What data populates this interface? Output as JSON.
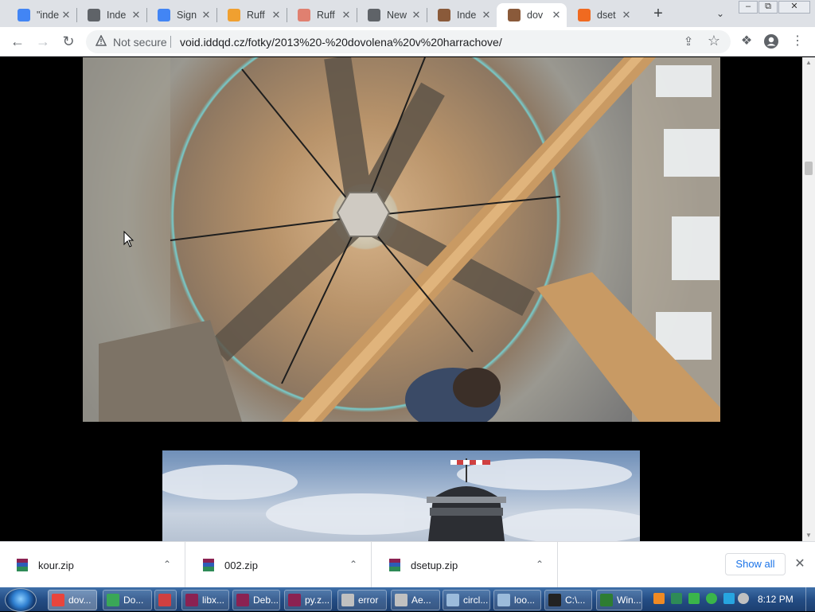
{
  "browser": {
    "tabs": [
      {
        "title": "\"inde",
        "favicon": "google-icon",
        "color": "#4285f4",
        "active": false
      },
      {
        "title": "Inde",
        "favicon": "globe-icon",
        "color": "#5f6368",
        "active": false
      },
      {
        "title": "Sign",
        "favicon": "google-icon",
        "color": "#4285f4",
        "active": false
      },
      {
        "title": "Ruff",
        "favicon": "ruffle-icon",
        "color": "#f0a030",
        "active": false
      },
      {
        "title": "Ruff",
        "favicon": "ruffle-icon",
        "color": "#e08070",
        "active": false
      },
      {
        "title": "New",
        "favicon": "chrome-icon",
        "color": "#5f6368",
        "active": false
      },
      {
        "title": "Inde",
        "favicon": "face-icon",
        "color": "#8a5a3a",
        "active": false
      },
      {
        "title": "dov",
        "favicon": "face-icon",
        "color": "#8a5a3a",
        "active": true
      },
      {
        "title": "dset",
        "favicon": "gear-icon",
        "color": "#f06a20",
        "active": false
      }
    ],
    "address": {
      "security_label": "Not secure",
      "url": "void.iddqd.cz/fotky/2013%20-%20dovolena%20v%20harrachove/"
    }
  },
  "downloads": {
    "items": [
      {
        "name": "kour.zip"
      },
      {
        "name": "002.zip"
      },
      {
        "name": "dsetup.zip"
      }
    ],
    "show_all_label": "Show all"
  },
  "taskbar": {
    "tasks": [
      {
        "label": "dov...",
        "color": "#e8453c"
      },
      {
        "label": "Do...",
        "color": "#3aa757"
      },
      {
        "label": "",
        "color": "#d04040"
      },
      {
        "label": "libx...",
        "color": "#8b2252"
      },
      {
        "label": "Deb...",
        "color": "#8b2252"
      },
      {
        "label": "py.z...",
        "color": "#8b2252"
      },
      {
        "label": "error",
        "color": "#c0c0c0"
      },
      {
        "label": "Ae...",
        "color": "#c0c0c0"
      },
      {
        "label": "circl...",
        "color": "#9bbbdb"
      },
      {
        "label": "loo...",
        "color": "#9bbbdb"
      },
      {
        "label": "C:\\...",
        "color": "#222222"
      },
      {
        "label": "Win...",
        "color": "#2e7d32"
      }
    ],
    "clock": "8:12 PM"
  },
  "colors": {
    "tabstrip": "#dee1e6",
    "link_blue": "#1a73e8",
    "taskbar": "#244d85"
  }
}
